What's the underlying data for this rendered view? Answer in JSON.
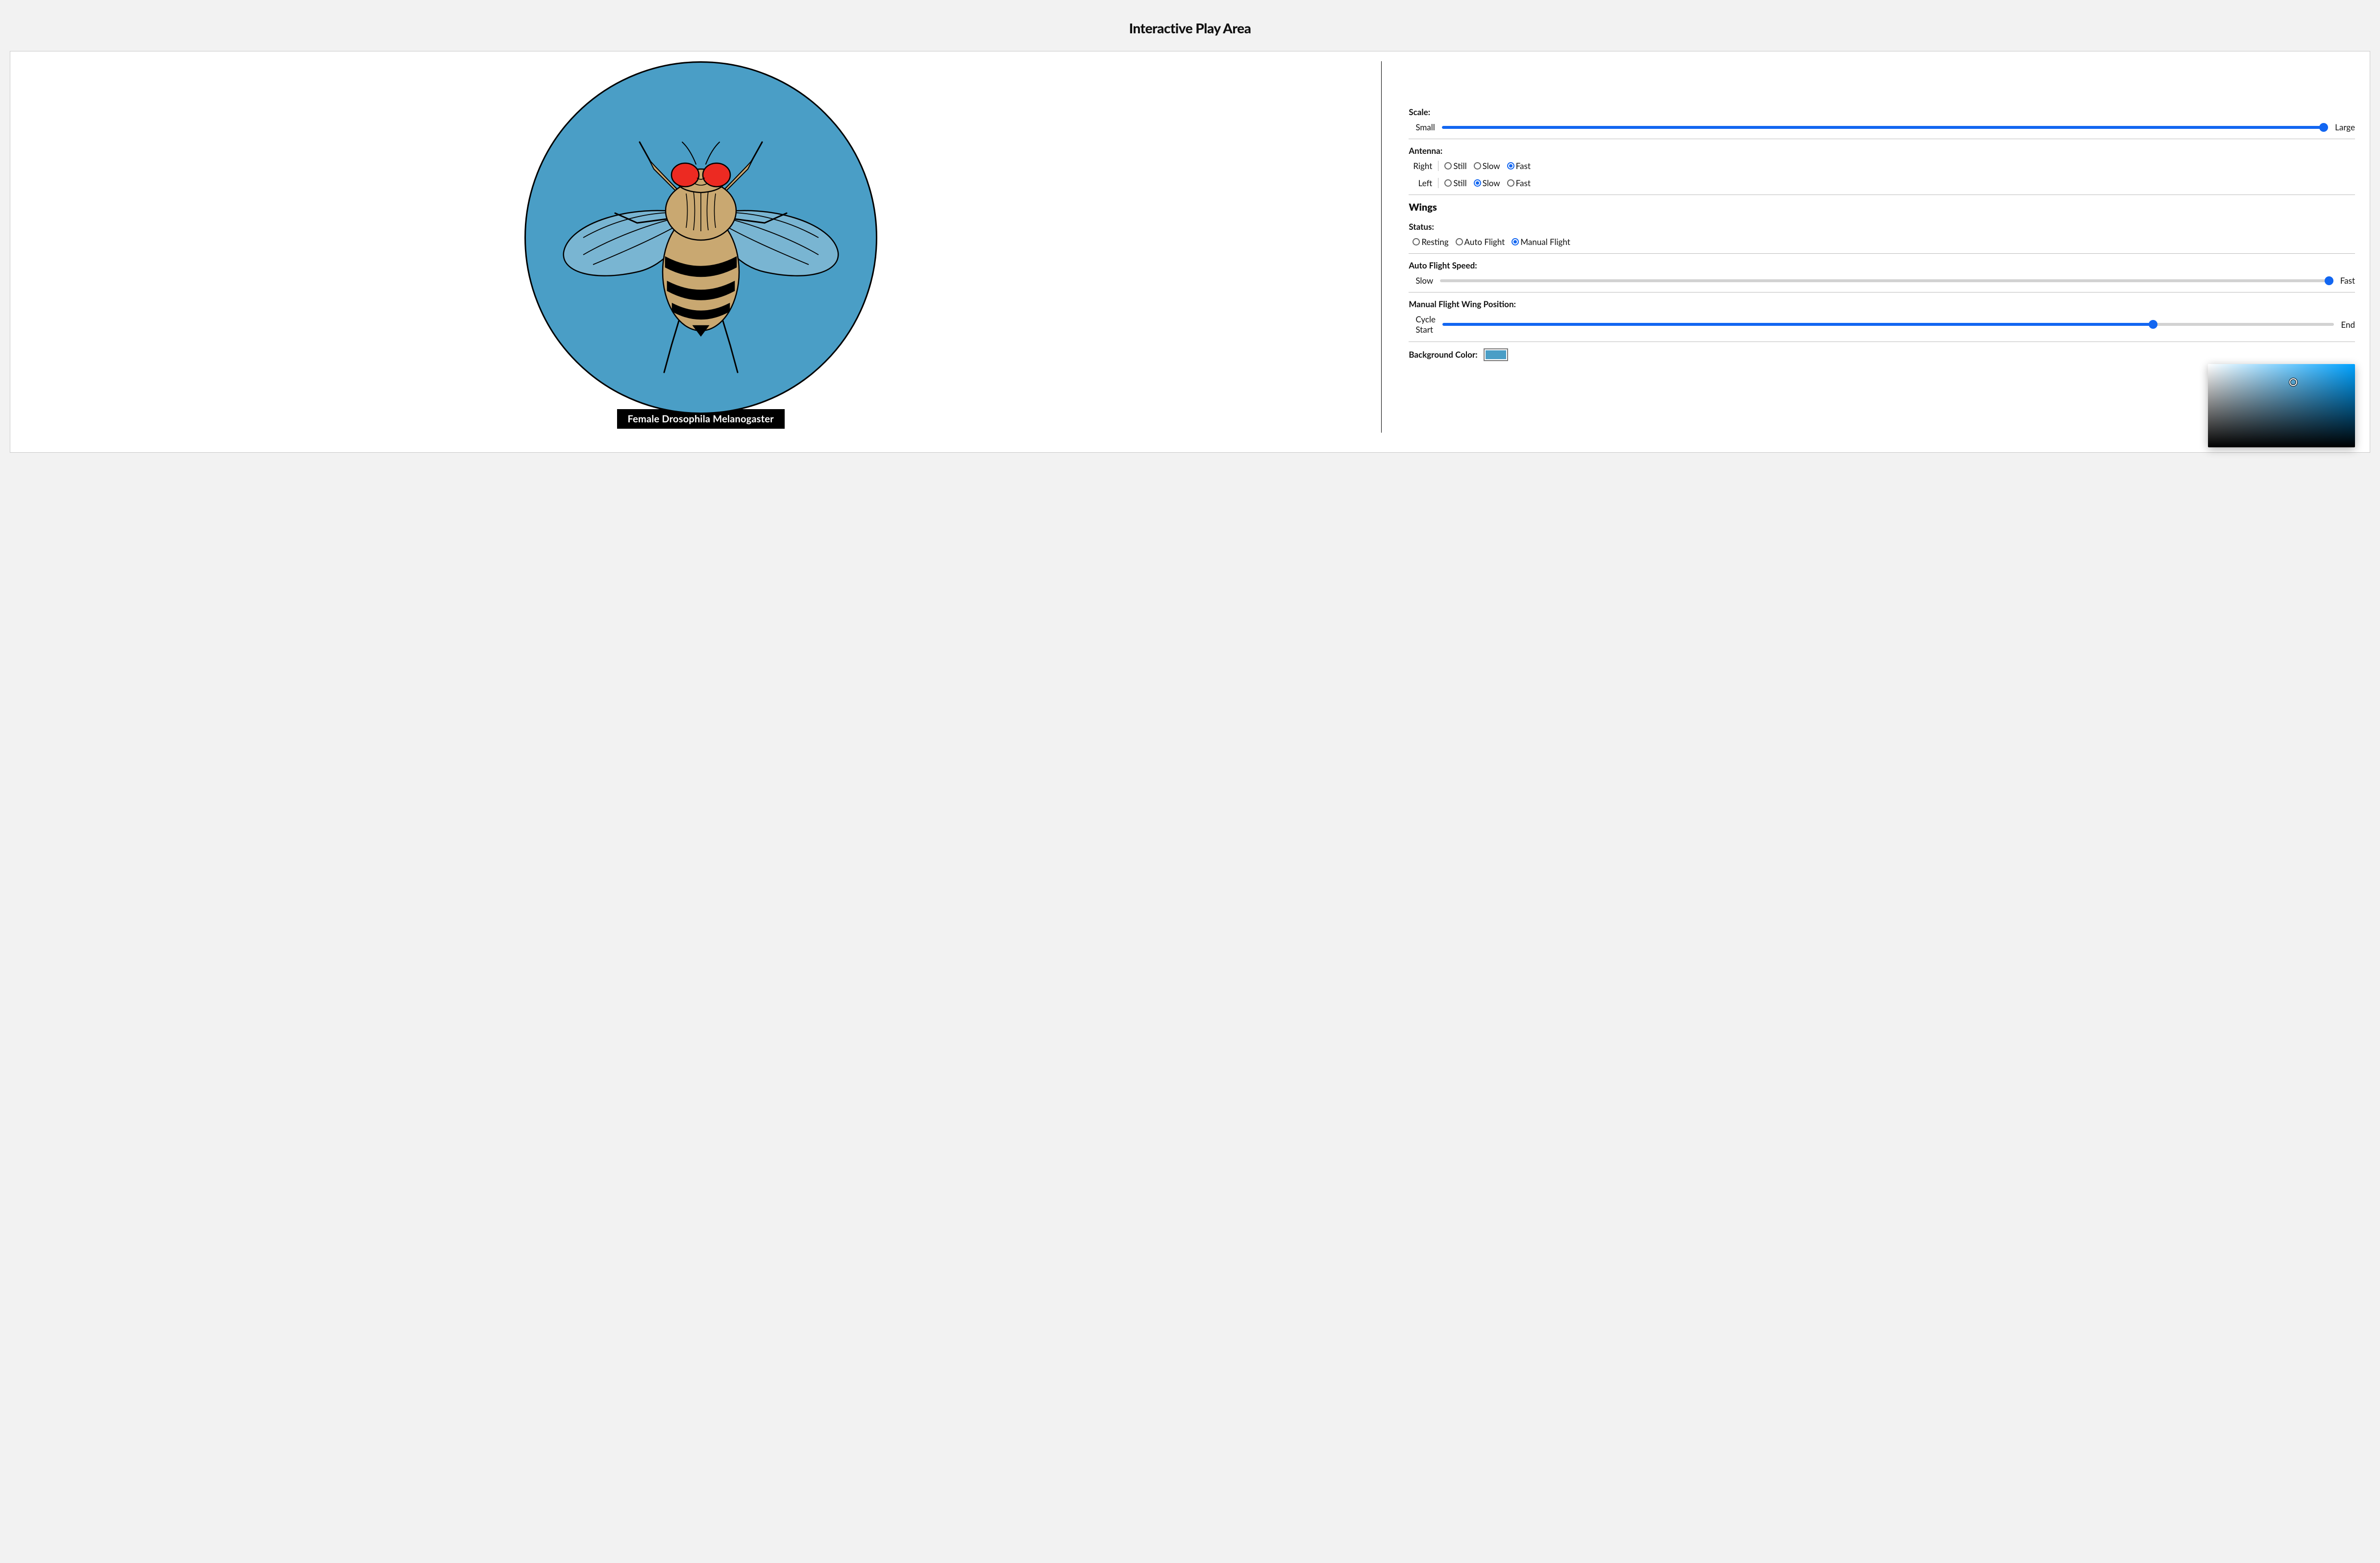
{
  "title": "Interactive Play Area",
  "caption": "Female Drosophila Melanogaster",
  "background_color": "#4a9ec6",
  "scale": {
    "label": "Scale:",
    "min_label": "Small",
    "max_label": "Large",
    "value": 100
  },
  "antenna": {
    "label": "Antenna:",
    "sides": {
      "right": {
        "label": "Right",
        "options": [
          "Still",
          "Slow",
          "Fast"
        ],
        "selected": "Fast"
      },
      "left": {
        "label": "Left",
        "options": [
          "Still",
          "Slow",
          "Fast"
        ],
        "selected": "Slow"
      }
    }
  },
  "wings": {
    "heading": "Wings",
    "status": {
      "label": "Status:",
      "options": [
        "Resting",
        "Auto Flight",
        "Manual Flight"
      ],
      "selected": "Manual Flight"
    },
    "auto_speed": {
      "label": "Auto Flight Speed:",
      "min_label": "Slow",
      "max_label": "Fast",
      "value": 100,
      "enabled": false
    },
    "manual_pos": {
      "label": "Manual Flight Wing Position:",
      "min_label": "Cycle Start",
      "max_label": "End",
      "value": 80
    }
  },
  "bg_label": "Background Color:"
}
